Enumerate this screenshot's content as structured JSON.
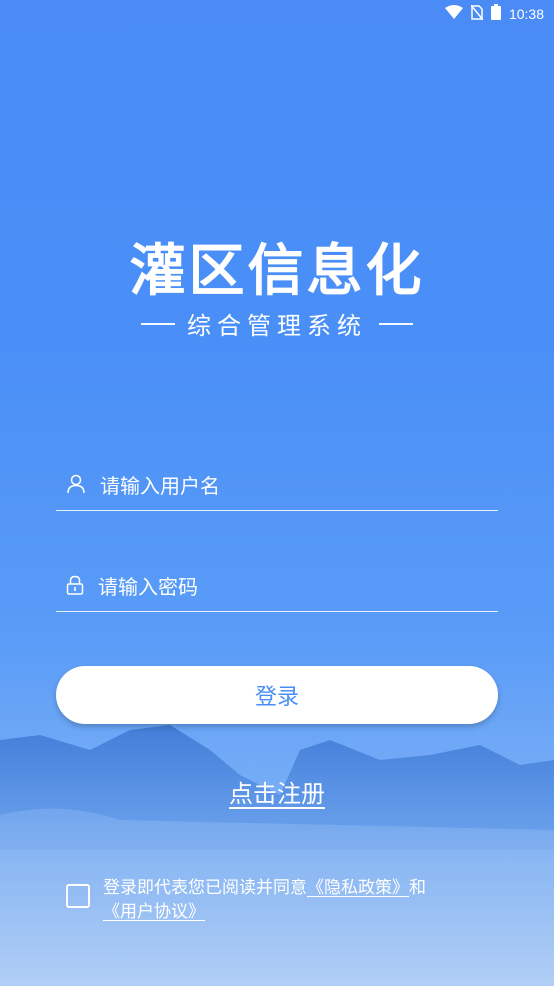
{
  "status_bar": {
    "time": "10:38"
  },
  "header": {
    "title": "灌区信息化",
    "subtitle": "综合管理系统"
  },
  "form": {
    "username_placeholder": "请输入用户名",
    "password_placeholder": "请输入密码",
    "login_label": "登录",
    "register_label": "点击注册"
  },
  "agreement": {
    "prefix": "登录即代表您已阅读并同意",
    "privacy_link": "《隐私政策》",
    "conjunction": "和",
    "terms_link": "《用户协议》",
    "checked": false
  },
  "colors": {
    "primary": "#4a8ff7",
    "button_text": "#4a8ff7"
  },
  "icons": [
    "wifi-icon",
    "no-sim-icon",
    "battery-icon",
    "user-icon",
    "lock-icon"
  ]
}
